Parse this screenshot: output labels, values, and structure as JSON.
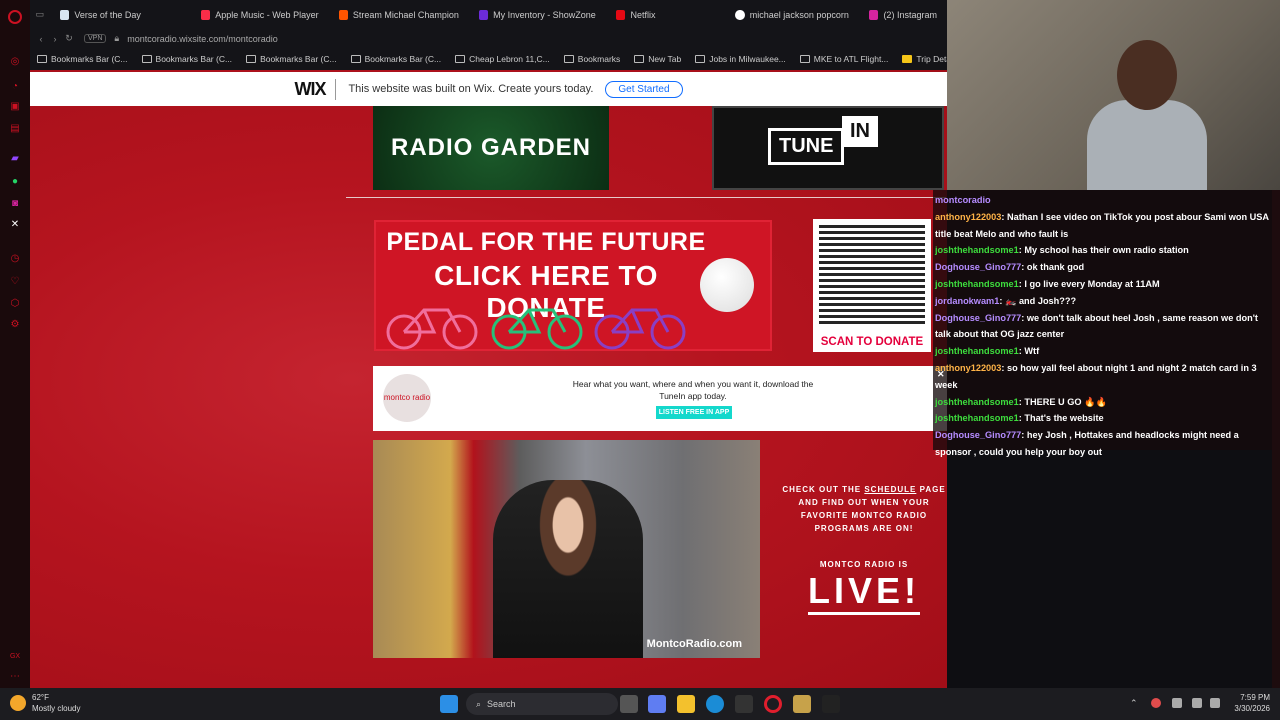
{
  "tabs": [
    {
      "label": "Verse of the Day",
      "color": "#d9e6f2"
    },
    {
      "label": "Apple Music - Web Player",
      "color": "#fa2d48"
    },
    {
      "label": "Stream Michael Champion",
      "color": "#ff5500"
    },
    {
      "label": "My Inventory - ShowZone",
      "color": "#6c2bd9"
    },
    {
      "label": "Netflix",
      "color": "#e50914"
    },
    {
      "label": "michael jackson popcorn",
      "color": "#ffffff"
    },
    {
      "label": "(2) Instagram",
      "color": "#d6249f"
    }
  ],
  "address": {
    "vpn": "VPN",
    "url": "montcoradio.wixsite.com/montcoradio"
  },
  "bookmarks": [
    "Bookmarks Bar (C...",
    "Bookmarks Bar (C...",
    "Bookmarks Bar (C...",
    "Bookmarks Bar (C...",
    "Cheap Lebron 11,C...",
    "Bookmarks",
    "New Tab",
    "Jobs in Milwaukee...",
    "MKE to ATL Flight...",
    "Trip Detail | Ex"
  ],
  "wix": {
    "logo": "WIX",
    "message": "This website was built on Wix. Create yours today.",
    "cta": "Get Started"
  },
  "radio_garden": "RADIO GARDEN",
  "tunein": {
    "word1": "TUNE",
    "word2": "IN"
  },
  "donate": {
    "line1": "PEDAL FOR THE FUTURE",
    "line2": "CLICK HERE TO DONATE"
  },
  "qr": {
    "caption": "SCAN TO DONATE"
  },
  "tunein_banner": {
    "logo": "montco radio",
    "message": "Hear what you want, where and when you want it, download the TuneIn app today.",
    "button": "LISTEN FREE IN APP"
  },
  "photo": {
    "watermark": "MontcoRadio.com"
  },
  "schedule": {
    "line1": "CHECK OUT THE",
    "link": "SCHEDULE",
    "line2": "PAGE AND FIND OUT WHEN YOUR FAVORITE MONTCO RADIO PROGRAMS ARE ON!"
  },
  "live": {
    "label": "MONTCO RADIO IS",
    "word": "LIVE!"
  },
  "chat": [
    {
      "user": "montcoradio",
      "text": "",
      "color": "#b58cff"
    },
    {
      "user": "anthony122003",
      "text": ": Nathan I see video on TikTok you post abour Sami won USA title beat Melo and who fault is",
      "color": "#ffb347"
    },
    {
      "user": "joshthehandsome1",
      "text": ": My school has their own radio station",
      "color": "#3ddc3d"
    },
    {
      "user": "Doghouse_Gino777",
      "text": ": ok thank god",
      "color": "#b58cff"
    },
    {
      "user": "joshthehandsome1",
      "text": ": I go live every Monday at 11AM",
      "color": "#3ddc3d"
    },
    {
      "user": "jordanokwam1",
      "text": ": 🏍️ and Josh???",
      "color": "#b58cff"
    },
    {
      "user": "Doghouse_Gino777",
      "text": ": we don't talk about heel Josh , same reason we don't talk about that OG jazz center",
      "color": "#b58cff"
    },
    {
      "user": "joshthehandsome1",
      "text": ": Wtf",
      "color": "#3ddc3d"
    },
    {
      "user": "anthony122003",
      "text": ": so how yall feel about night 1 and night 2 match card in 3 week",
      "color": "#ffb347"
    },
    {
      "user": "joshthehandsome1",
      "text": ": THERE U GO 🔥🔥",
      "color": "#3ddc3d"
    },
    {
      "user": "joshthehandsome1",
      "text": ": That's the website",
      "color": "#3ddc3d"
    },
    {
      "user": "Doghouse_Gino777",
      "text": ": hey Josh , Hottakes and headlocks might need a sponsor , could you help your boy out",
      "color": "#b58cff"
    }
  ],
  "taskbar": {
    "temp": "62°F",
    "weather": "Mostly cloudy",
    "search": "Search",
    "time": "7:59 PM",
    "date": "3/30/2026"
  }
}
